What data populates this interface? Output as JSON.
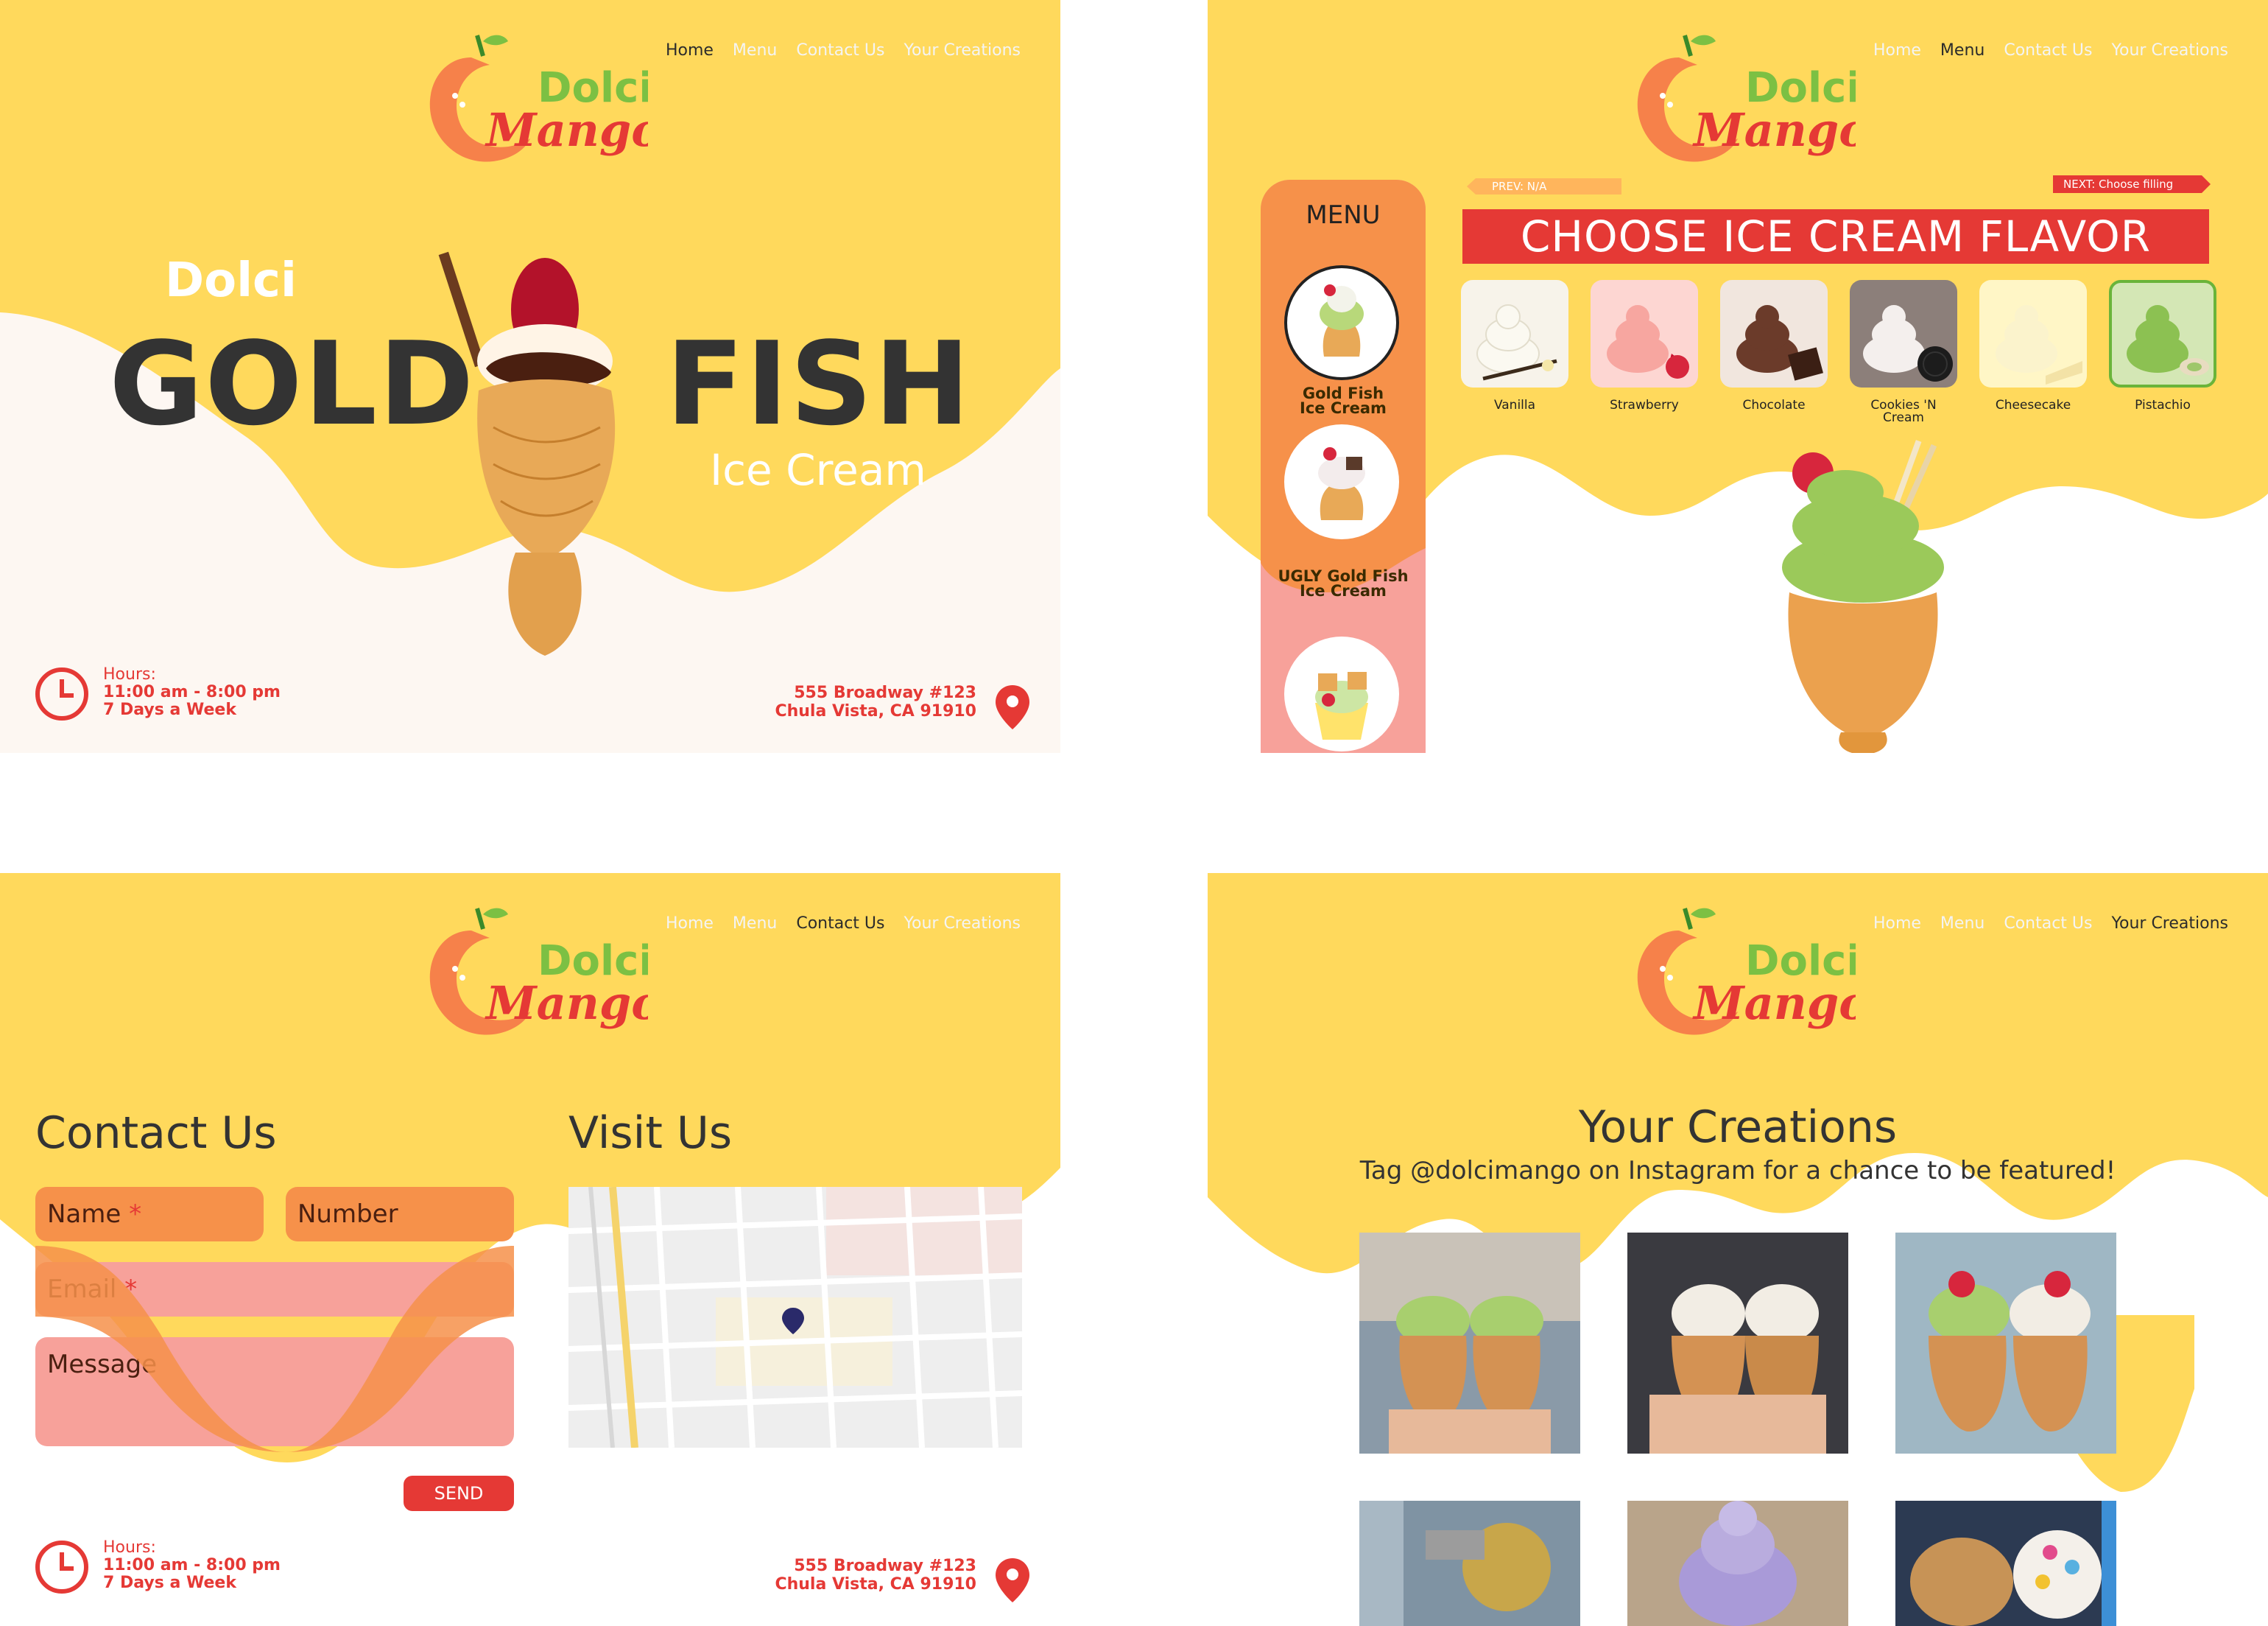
{
  "colors": {
    "yellow": "#ffd95c",
    "cream": "#fdf7f2",
    "red": "#e53935",
    "orange": "#f6914a",
    "pink": "#f7a19a",
    "dark_text": "#333333",
    "nav_inactive": "#f4f4f4"
  },
  "brand": {
    "logo_top": "Dolci",
    "logo_bottom": "Mango"
  },
  "nav": {
    "home": "Home",
    "menu": "Menu",
    "contact": "Contact Us",
    "creations": "Your Creations"
  },
  "hours": {
    "label": "Hours:",
    "time": "11:00 am - 8:00 pm",
    "days": "7 Days a Week"
  },
  "address": {
    "line1": "555 Broadway #123",
    "line2": "Chula Vista, CA 91910"
  },
  "home": {
    "dolci": "Dolci",
    "gold": "GOLD",
    "fish": "FISH",
    "ice_cream": "Ice Cream"
  },
  "menu_page": {
    "menu_title": "MENU",
    "items": [
      {
        "line1": "Gold Fish",
        "line2": "Ice Cream"
      },
      {
        "line1": "UGLY Gold Fish",
        "line2": "Ice Cream"
      }
    ],
    "prev": "PREV: N/A",
    "next": "NEXT: Choose filling",
    "heading": "CHOOSE ICE CREAM FLAVOR",
    "flavors": [
      {
        "name": "Vanilla",
        "selected": false
      },
      {
        "name": "Strawberry",
        "selected": false
      },
      {
        "name": "Chocolate",
        "selected": false
      },
      {
        "name": "Cookies 'N Cream",
        "selected": false
      },
      {
        "name": "Cheesecake",
        "selected": false
      },
      {
        "name": "Pistachio",
        "selected": true
      }
    ]
  },
  "contact_page": {
    "heading": "Contact Us",
    "visit_heading": "Visit Us",
    "name_field": "Name",
    "number_field": "Number",
    "email_field": "Email",
    "message_field": "Message",
    "required_mark": "*",
    "send": "SEND"
  },
  "creations_page": {
    "heading": "Your Creations",
    "subheading": "Tag @dolcimango on Instagram for a chance to be featured!"
  },
  "icons": [
    "clock-icon",
    "map-pin-icon",
    "mango-logo-icon"
  ]
}
